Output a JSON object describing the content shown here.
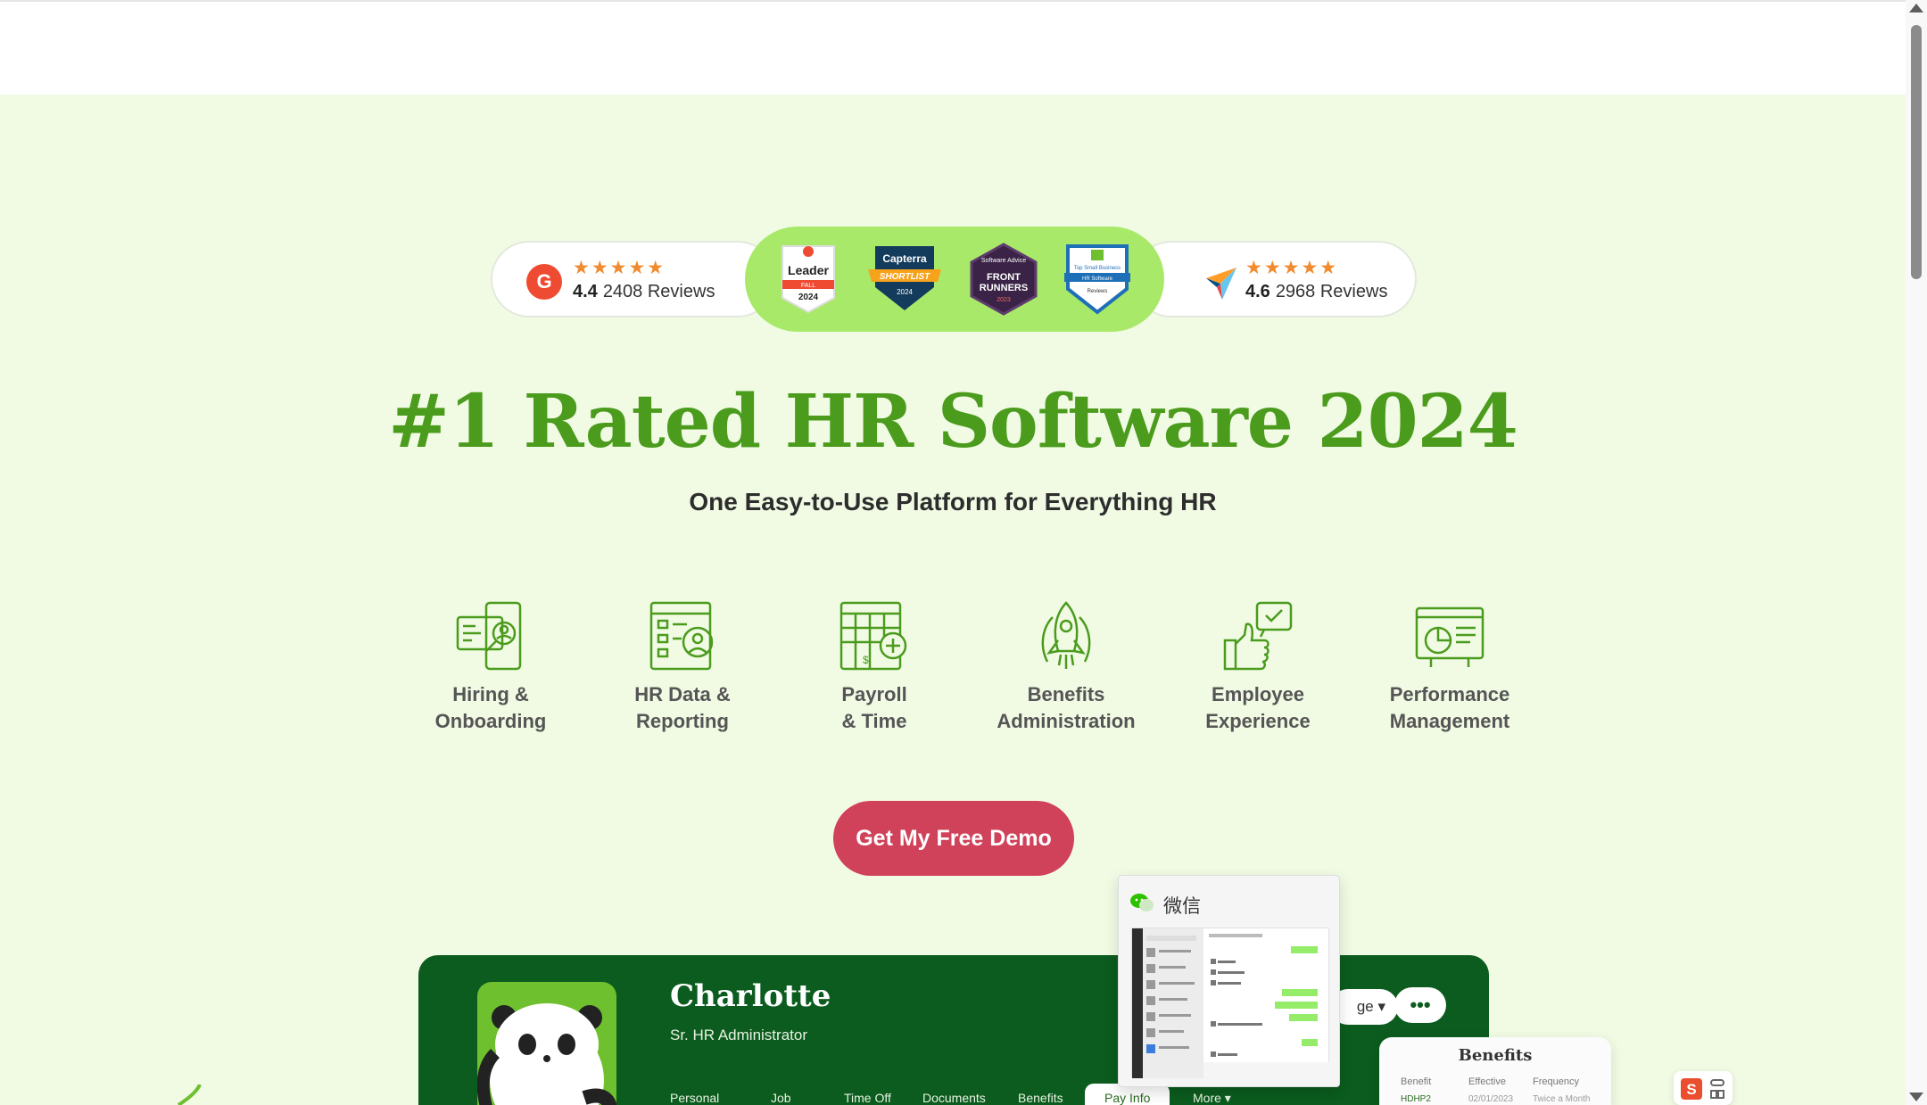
{
  "ratings": {
    "left": {
      "logo": "g2-logo",
      "logo_text": "G",
      "stars": "★★★★★",
      "score": "4.4",
      "reviews": "2408 Reviews"
    },
    "right": {
      "logo": "capterra-logo",
      "stars": "★★★★★",
      "score": "4.6",
      "reviews": "2968 Reviews"
    },
    "badges": [
      {
        "name": "g2-leader-badge",
        "line1": "Leader",
        "line2": "FALL",
        "line3": "2024"
      },
      {
        "name": "capterra-shortlist-badge",
        "line1": "Capterra",
        "line2": "SHORTLIST",
        "line3": "2024"
      },
      {
        "name": "software-advice-badge",
        "line1": "Software Advice",
        "line2": "FRONT",
        "line3": "RUNNERS",
        "line4": "2023"
      },
      {
        "name": "top-small-business-badge",
        "line1": "Top Small Business",
        "line2": "HR Software",
        "line3": "Reviews"
      }
    ]
  },
  "hero": {
    "headline": "#1 Rated HR Software 2024",
    "subheadline": "One Easy-to-Use Platform for Everything HR",
    "cta_label": "Get My Free Demo"
  },
  "features": [
    {
      "name": "hiring-onboarding",
      "icon": "hiring-icon",
      "label": "Hiring &\nOnboarding"
    },
    {
      "name": "hr-data-reporting",
      "icon": "hr-data-icon",
      "label": "HR Data &\nReporting"
    },
    {
      "name": "payroll-time",
      "icon": "payroll-icon",
      "label": "Payroll\n& Time"
    },
    {
      "name": "benefits-administration",
      "icon": "benefits-rocket-icon",
      "label": "Benefits\nAdministration"
    },
    {
      "name": "employee-experience",
      "icon": "thumbs-up-icon",
      "label": "Employee\nExperience"
    },
    {
      "name": "performance-management",
      "icon": "performance-icon",
      "label": "Performance\nManagement"
    }
  ],
  "profile": {
    "name": "Charlotte",
    "role": "Sr. HR Administrator",
    "tabs": [
      "Personal",
      "Job",
      "Time Off",
      "Documents",
      "Benefits",
      "Pay Info",
      "More ▾"
    ],
    "active_tab": "Pay Info",
    "change_button": "ge ▾",
    "more_button": "•••"
  },
  "wechat": {
    "title": "微信"
  },
  "benefits_card": {
    "title": "Benefits",
    "columns": [
      "Benefit",
      "Effective",
      "Frequency"
    ],
    "row": [
      "HDHP2",
      "02/01/2023",
      "Twice a Month"
    ]
  },
  "colors": {
    "hero_bg": "#f1fbe4",
    "headline": "#4b9b1d",
    "cta": "#d0415a",
    "badge_pill": "#a9e96a",
    "profile_bg": "#0b5c1e",
    "star": "#f08b2f"
  }
}
